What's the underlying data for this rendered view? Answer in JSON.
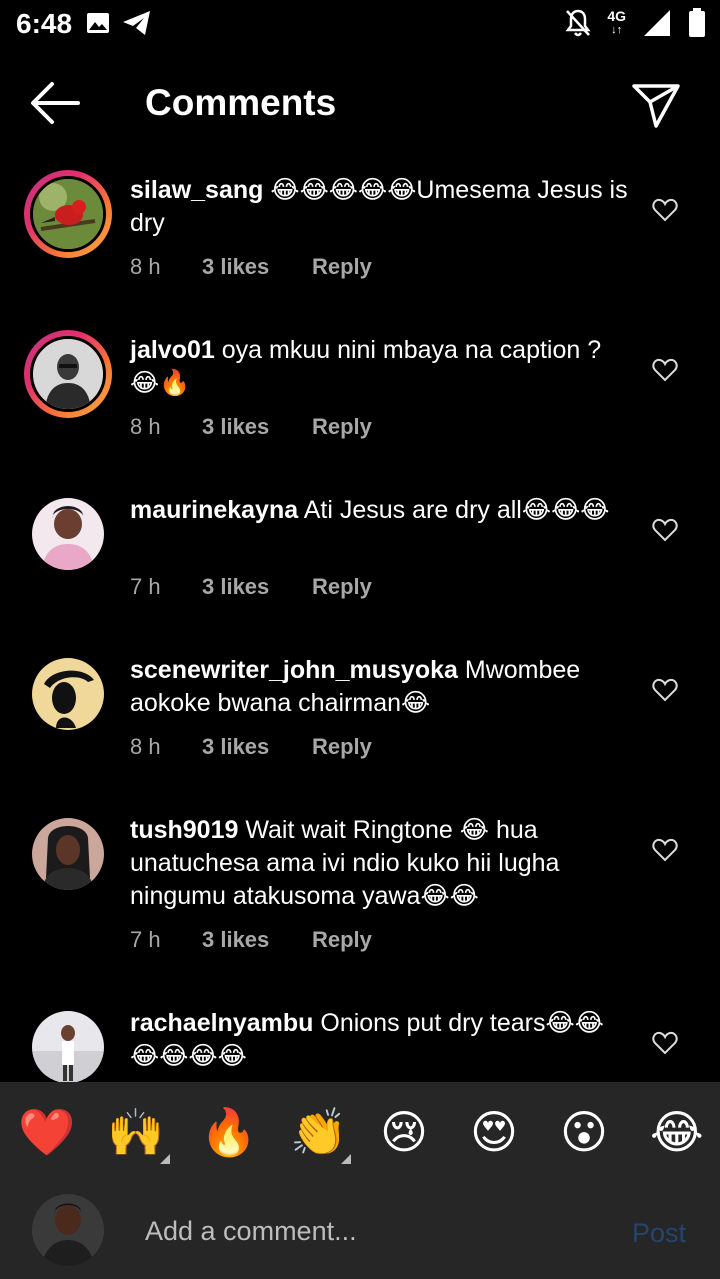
{
  "status": {
    "time": "6:48",
    "network": "4G"
  },
  "header": {
    "title": "Comments"
  },
  "comments": [
    {
      "user": "silaw_sang",
      "text": "😂😂😂😂😂Umesema Jesus is dry",
      "time": "8 h",
      "likes": "3 likes",
      "reply": "Reply"
    },
    {
      "user": "jalvo01",
      "text": "oya mkuu nini mbaya na caption ?😂🔥",
      "time": "8 h",
      "likes": "3 likes",
      "reply": "Reply"
    },
    {
      "user": "maurinekayna",
      "text": "Ati Jesus are dry all😂😂😂",
      "time": "7 h",
      "likes": "3 likes",
      "reply": "Reply"
    },
    {
      "user": "scenewriter_john_musyoka",
      "text": "Mwombee aokoke bwana chairman😂",
      "time": "8 h",
      "likes": "3 likes",
      "reply": "Reply"
    },
    {
      "user": "tush9019",
      "text": "Wait wait Ringtone 😂 hua unatuchesa ama ivi ndio kuko hii lugha ningumu atakusoma yawa😂😂",
      "time": "7 h",
      "likes": "3 likes",
      "reply": "Reply"
    },
    {
      "user": "rachaelnyambu",
      "text": "Onions  put dry  tears😂😂😂😂😂😂",
      "time": "",
      "likes": "",
      "reply": ""
    }
  ],
  "reactions": [
    "❤️",
    "🙌",
    "🔥",
    "👏",
    "😢",
    "😍",
    "😮",
    "😂"
  ],
  "composer": {
    "placeholder": "Add a comment...",
    "post": "Post"
  },
  "colors": {
    "background": "#000000",
    "bar": "#262626",
    "post_disabled": "#24456e",
    "meta": "#a8a8a8"
  }
}
